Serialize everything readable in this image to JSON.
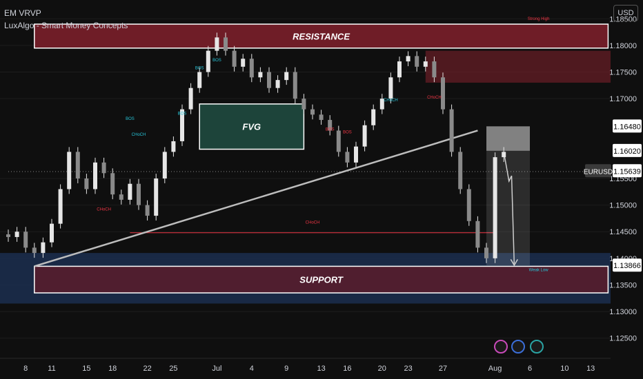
{
  "header": {
    "symbol_line": "EM VRVP",
    "indicator_line": "LuxAlgo - Smart Money Concepts"
  },
  "currency_button": "USD",
  "symbol_badge": "EURUSD",
  "colors": {
    "background": "#0f0f0f",
    "candle": "#e6e6e6",
    "resistance": "#7a1f2a",
    "support_band": "#1c2f52",
    "fvg": "#1f4a3f",
    "bos": "#26c6da",
    "choch": "#f23645",
    "trendline": "#bdbdbd"
  },
  "chart_data": {
    "type": "candlestick",
    "ylim": [
      1.1225,
      1.1875
    ],
    "y_ticks": [
      "1.18500",
      "1.18000",
      "1.17500",
      "1.17000",
      "1.15500",
      "1.15000",
      "1.14500",
      "1.14000",
      "1.13500",
      "1.13000",
      "1.12500"
    ],
    "price_labels": [
      {
        "text": "1.16480",
        "value": 1.1648,
        "style": "white"
      },
      {
        "text": "1.16020",
        "value": 1.1602,
        "style": "white"
      },
      {
        "text": "EURUSD",
        "value": 1.15639,
        "style": "gray"
      },
      {
        "text": "1.15639",
        "value": 1.15639,
        "style": "white"
      },
      {
        "text": "1.13866",
        "value": 1.13866,
        "style": "white"
      }
    ],
    "x_labels": [
      {
        "text": "8",
        "bar": 2
      },
      {
        "text": "11",
        "bar": 5
      },
      {
        "text": "15",
        "bar": 9
      },
      {
        "text": "18",
        "bar": 12
      },
      {
        "text": "22",
        "bar": 16
      },
      {
        "text": "25",
        "bar": 19
      },
      {
        "text": "Jul",
        "bar": 24
      },
      {
        "text": "4",
        "bar": 28
      },
      {
        "text": "9",
        "bar": 32
      },
      {
        "text": "13",
        "bar": 36
      },
      {
        "text": "16",
        "bar": 39
      },
      {
        "text": "20",
        "bar": 43
      },
      {
        "text": "23",
        "bar": 46
      },
      {
        "text": "27",
        "bar": 50
      },
      {
        "text": "Aug",
        "bar": 56
      },
      {
        "text": "6",
        "bar": 60
      },
      {
        "text": "10",
        "bar": 64
      },
      {
        "text": "13",
        "bar": 67
      }
    ],
    "closes": [
      1.144,
      1.145,
      1.142,
      1.141,
      1.143,
      1.1465,
      1.153,
      1.16,
      1.155,
      1.153,
      1.158,
      1.156,
      1.152,
      1.151,
      1.154,
      1.15,
      1.148,
      1.155,
      1.16,
      1.162,
      1.168,
      1.172,
      1.175,
      1.179,
      1.1815,
      1.179,
      1.176,
      1.1775,
      1.174,
      1.175,
      1.172,
      1.1735,
      1.175,
      1.17,
      1.168,
      1.167,
      1.166,
      1.164,
      1.16,
      1.158,
      1.161,
      1.165,
      1.168,
      1.17,
      1.174,
      1.177,
      1.178,
      1.176,
      1.177,
      1.174,
      1.168,
      1.16,
      1.153,
      1.147,
      1.142,
      1.14,
      1.159,
      1.16
    ],
    "zones": [
      {
        "label": "RESISTANCE",
        "y_top": 1.184,
        "y_bottom": 1.1795,
        "bar_start": 3,
        "bar_end": 69
      },
      {
        "label": "SUPPORT",
        "y_top": 1.1385,
        "y_bottom": 1.1335,
        "bar_start": 3,
        "bar_end": 69
      },
      {
        "label": "FVG",
        "y_top": 1.169,
        "y_bottom": 1.1605,
        "bar_start": 22,
        "bar_end": 34
      }
    ],
    "trendline": {
      "from": {
        "bar": 3,
        "value": 1.1385
      },
      "to": {
        "bar": 54,
        "value": 1.164
      }
    },
    "annotations": [
      {
        "text": "BOS",
        "color": "bos",
        "bar": 14,
        "value": 1.166
      },
      {
        "text": "BOS",
        "color": "bos",
        "bar": 20,
        "value": 1.167
      },
      {
        "text": "BOS",
        "color": "bos",
        "bar": 22,
        "value": 1.1755
      },
      {
        "text": "BOS",
        "color": "bos",
        "bar": 24,
        "value": 1.177
      },
      {
        "text": "CHoCH",
        "color": "bos",
        "bar": 15,
        "value": 1.163
      },
      {
        "text": "CHoCH",
        "color": "choch",
        "bar": 11,
        "value": 1.149
      },
      {
        "text": "CHoCH",
        "color": "choch",
        "bar": 35,
        "value": 1.1465
      },
      {
        "text": "CHoCH",
        "color": "choch",
        "bar": 49,
        "value": 1.17
      },
      {
        "text": "BOS",
        "color": "choch",
        "bar": 37,
        "value": 1.164
      },
      {
        "text": "BOS",
        "color": "choch",
        "bar": 39,
        "value": 1.1635
      },
      {
        "text": "CHoCH",
        "color": "bos",
        "bar": 44,
        "value": 1.1695
      },
      {
        "text": "Strong High",
        "color": "choch",
        "bar": 61,
        "value": 1.1848
      },
      {
        "text": "Weak Low",
        "color": "bos",
        "bar": 61,
        "value": 1.1376
      }
    ],
    "horizontal_lines": [
      {
        "value": 1.1448,
        "bar_start": 14,
        "bar_end": 56,
        "color": "choch"
      },
      {
        "value": 1.1563,
        "bar_start": 0,
        "bar_end": 69,
        "color": "dotted"
      }
    ]
  }
}
